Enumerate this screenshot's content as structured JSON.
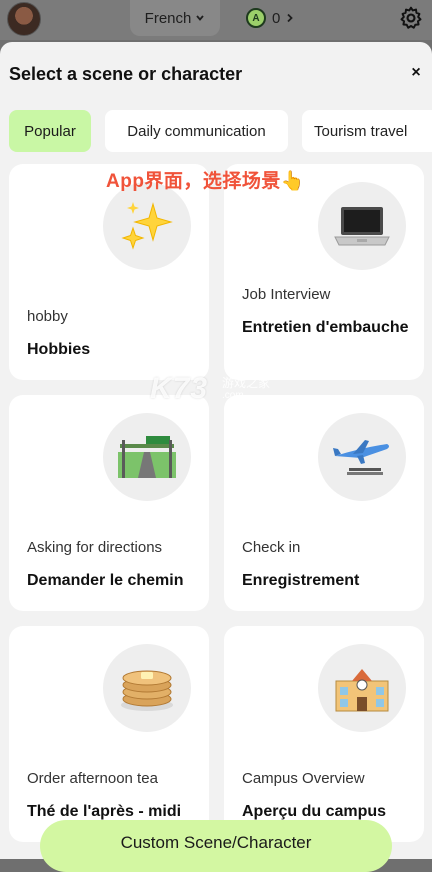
{
  "topbar": {
    "language": "French",
    "coins": "0",
    "avatar_icon": "user-avatar",
    "gear_icon": "gear-icon"
  },
  "sheet": {
    "title": "Select a scene or character",
    "close_label": "×"
  },
  "tabs": [
    {
      "label": "Popular",
      "active": true
    },
    {
      "label": "Daily communication",
      "active": false
    },
    {
      "label": "Tourism travel",
      "active": false
    }
  ],
  "overlay_caption": "App界面，选择场景👆",
  "watermark": {
    "brand": "K73",
    "sub": "游戏之家",
    "url": ".com"
  },
  "cards": [
    {
      "icon": "sparkles-icon",
      "subtitle": "hobby",
      "title": "Hobbies"
    },
    {
      "icon": "laptop-icon",
      "subtitle": "Job Interview",
      "title": "Entretien d'embauche"
    },
    {
      "icon": "road-sign-icon",
      "subtitle": "Asking for directions",
      "title": "Demander le chemin"
    },
    {
      "icon": "airplane-icon",
      "subtitle": "Check in",
      "title": "Enregistrement"
    },
    {
      "icon": "pancakes-icon",
      "subtitle": "Order afternoon tea",
      "title": "Thé de l'après - midi"
    },
    {
      "icon": "school-building-icon",
      "subtitle": "Campus Overview",
      "title": "Aperçu du campus"
    }
  ],
  "custom_button": "Custom Scene/Character",
  "colors": {
    "accent_green": "#c9f7a5",
    "caption_red": "#f0533a",
    "sheet_bg": "#f2f2f2"
  }
}
